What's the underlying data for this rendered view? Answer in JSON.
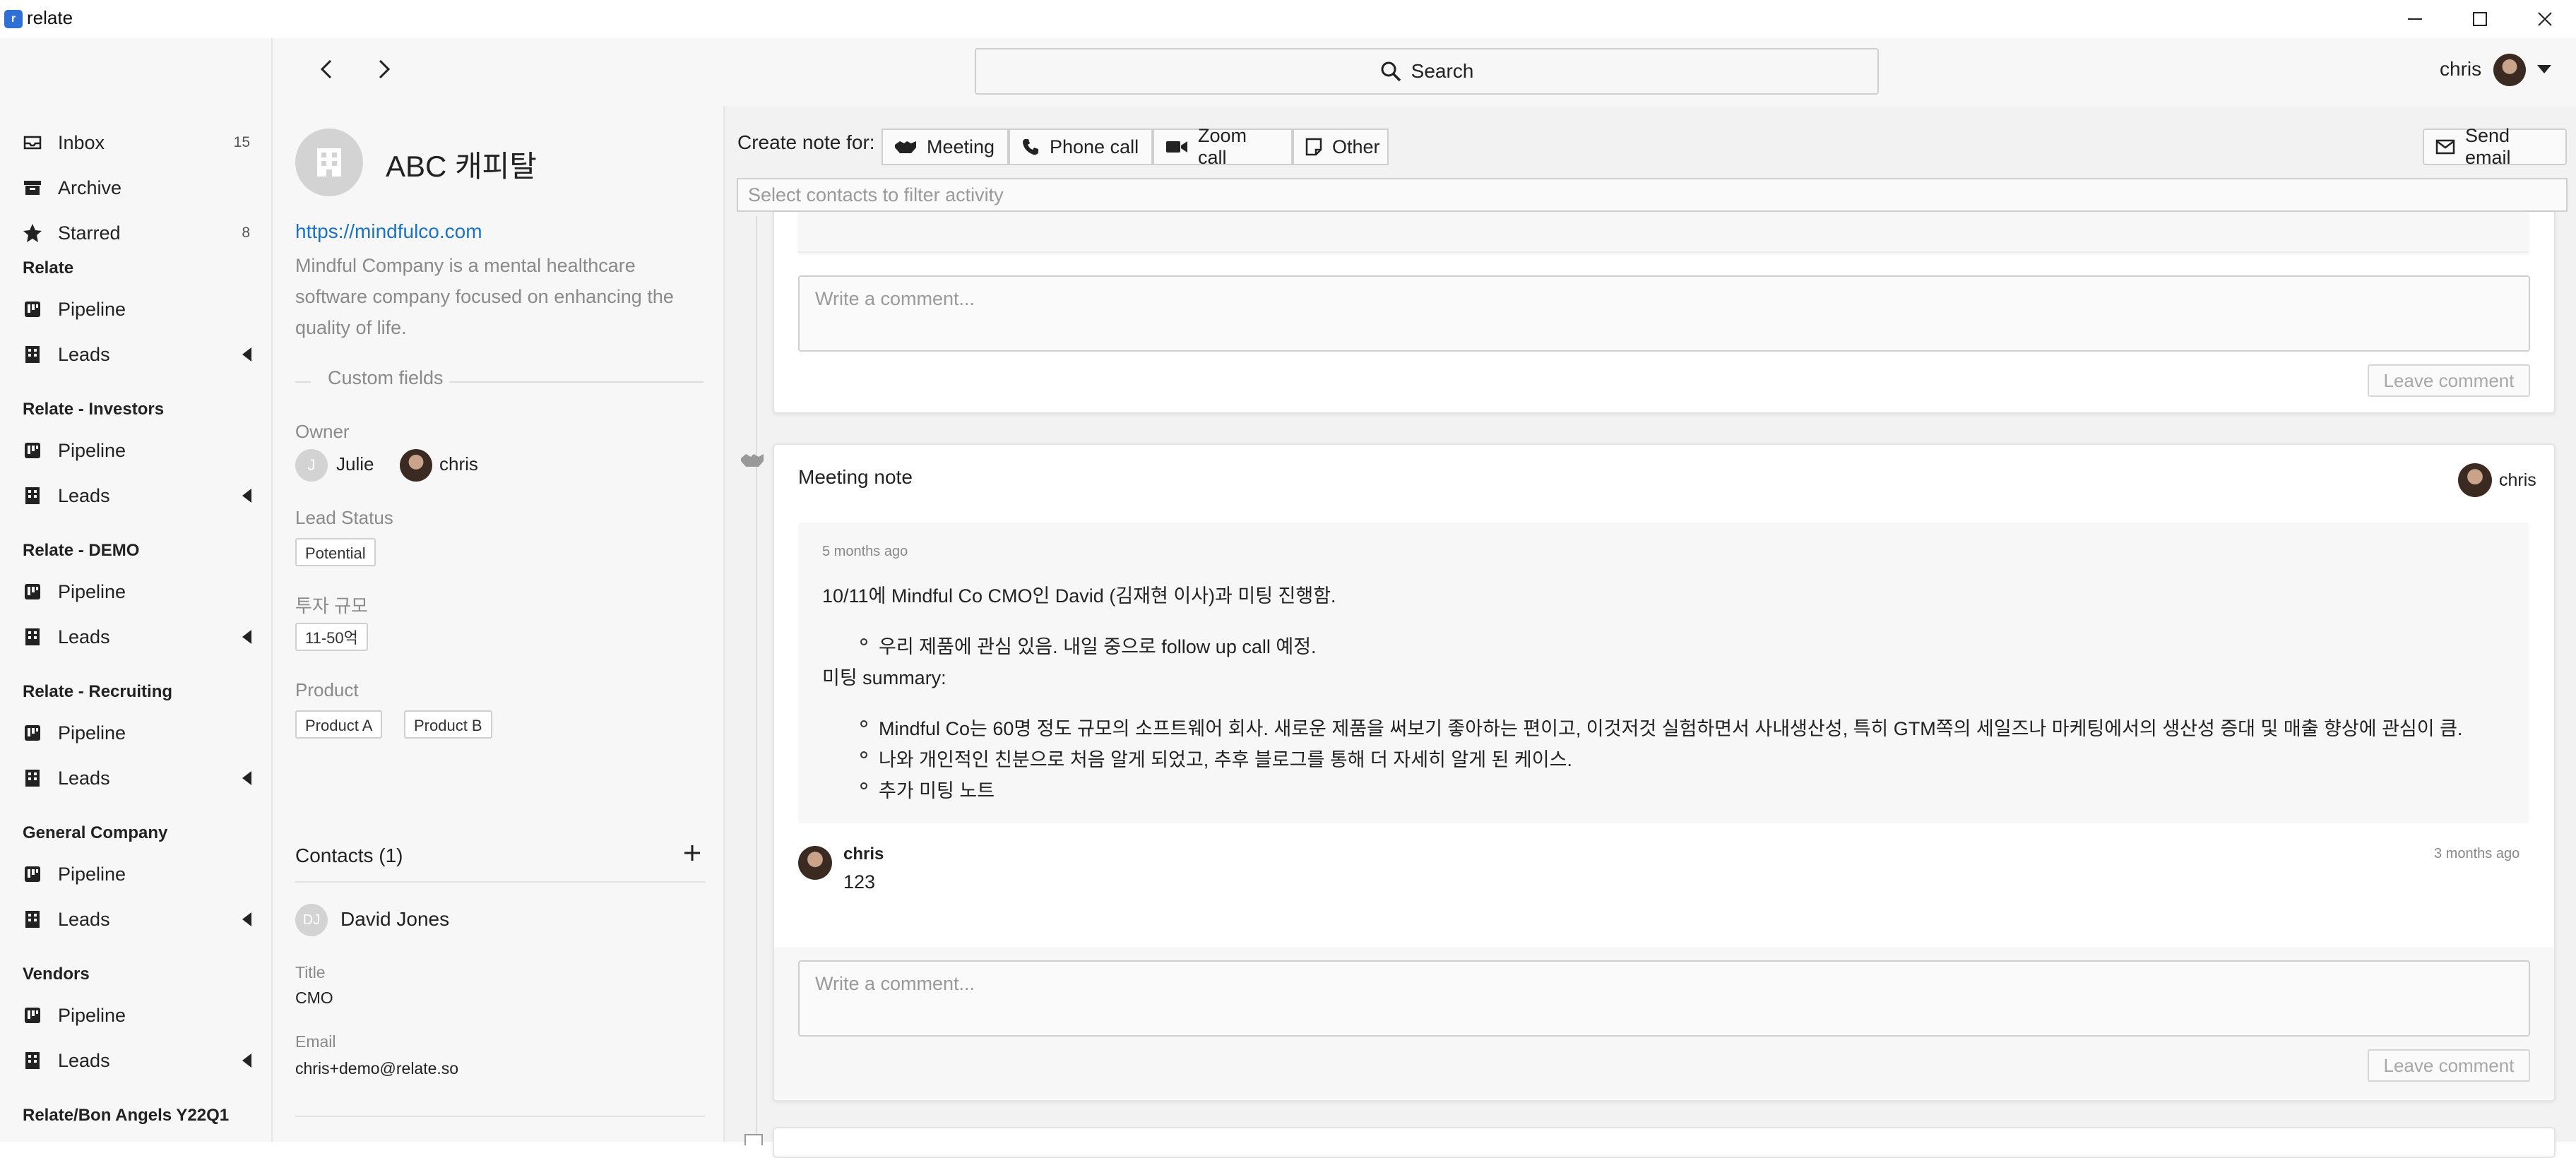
{
  "window": {
    "app_title": "relate",
    "app_icon_letter": "r"
  },
  "sidebar": {
    "inbox": {
      "label": "Inbox",
      "count": "15"
    },
    "archive": {
      "label": "Archive"
    },
    "starred": {
      "label": "Starred",
      "count": "8"
    },
    "sections": [
      {
        "title": "Relate",
        "pipeline": "Pipeline",
        "leads": "Leads"
      },
      {
        "title": "Relate - Investors",
        "pipeline": "Pipeline",
        "leads": "Leads"
      },
      {
        "title": "Relate - DEMO",
        "pipeline": "Pipeline",
        "leads": "Leads"
      },
      {
        "title": "Relate - Recruiting",
        "pipeline": "Pipeline",
        "leads": "Leads"
      },
      {
        "title": "General Company",
        "pipeline": "Pipeline",
        "leads": "Leads"
      },
      {
        "title": "Vendors",
        "pipeline": "Pipeline",
        "leads": "Leads"
      }
    ],
    "last_section": "Relate/Bon Angels Y22Q1"
  },
  "header": {
    "search_label": "Search",
    "user_name": "chris"
  },
  "company": {
    "name": "ABC 캐피탈",
    "url": "https://mindfulco.com",
    "description": "Mindful Company is a mental healthcare software company focused on enhancing the quality of life.",
    "custom_fields_label": "Custom fields",
    "owner_label": "Owner",
    "owners": [
      {
        "initial": "J",
        "name": "Julie"
      },
      {
        "initial": "",
        "name": "chris"
      }
    ],
    "lead_status_label": "Lead Status",
    "lead_status": "Potential",
    "investment_label": "투자 규모",
    "investment": "11-50억",
    "product_label": "Product",
    "products": [
      "Product A",
      "Product B"
    ],
    "contacts_label": "Contacts (1)",
    "contact": {
      "initials": "DJ",
      "name": "David Jones",
      "title_label": "Title",
      "title": "CMO",
      "email_label": "Email",
      "email": "chris+demo@relate.so"
    }
  },
  "activity": {
    "create_note_label": "Create note for:",
    "note_types": [
      "Meeting",
      "Phone call",
      "Zoom call",
      "Other"
    ],
    "send_email_label": "Send email",
    "filter_placeholder": "Select contacts to filter activity",
    "comment_placeholder": "Write a comment...",
    "leave_comment_label": "Leave comment",
    "meeting_note": {
      "title": "Meeting note",
      "author": "chris",
      "time": "5 months ago",
      "lines": [
        "10/11에 Mindful Co CMO인 David (김재현 이사)과 미팅 진행함.",
        "우리 제품에 관심 있음. 내일 중으로 follow up call 예정.",
        "미팅 summary:",
        "Mindful Co는 60명 정도 규모의 소프트웨어 회사. 새로운 제품을 써보기 좋아하는 편이고, 이것저것 실험하면서 사내생산성, 특히 GTM쪽의 세일즈나 마케팅에서의 생산성 증대 및 매출 향상에 관심이 큼.",
        "나와 개인적인 친분으로 처음 알게 되었고, 추후 블로그를 통해 더 자세히 알게 된 케이스.",
        "추가 미팅 노트"
      ],
      "comment": {
        "author": "chris",
        "time": "3 months ago",
        "text": "123"
      }
    }
  },
  "colors": {
    "link": "#1a73c8",
    "accent": "#2f6fd6"
  }
}
